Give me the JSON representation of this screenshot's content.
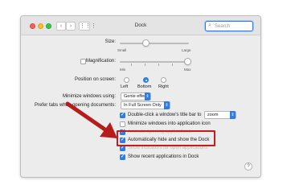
{
  "window": {
    "title": "Dock"
  },
  "search": {
    "placeholder": "Search",
    "icon": "magnifier"
  },
  "size": {
    "label": "Size:",
    "min_label": "Small",
    "max_label": "Large",
    "value_fraction": 0.35
  },
  "magnification": {
    "label": "Magnification:",
    "checked": false,
    "min_label": "Min",
    "max_label": "Max",
    "value_fraction": 0.97
  },
  "position": {
    "label": "Position on screen:",
    "options": [
      "Left",
      "Bottom",
      "Right"
    ],
    "selected": "Bottom"
  },
  "minimize_using": {
    "label": "Minimize windows using:",
    "value": "Genie effect"
  },
  "prefer_tabs": {
    "label": "Prefer tabs when opening documents:",
    "value": "In Full Screen Only"
  },
  "checkboxes": [
    {
      "label": "Double-click a window's title bar to",
      "checked": true,
      "popup": "zoom"
    },
    {
      "label": "Minimize windows into application icon",
      "checked": false
    },
    {
      "label": "Animate opening applications",
      "checked": true
    },
    {
      "label": "Automatically hide and show the Dock",
      "checked": true
    },
    {
      "label": "Show indicators for open applications",
      "checked": true
    },
    {
      "label": "Show recent applications in Dock",
      "checked": true
    }
  ],
  "help": {
    "label": "?"
  },
  "colors": {
    "accent": "#2f7de1",
    "highlight": "#c41d1d"
  }
}
